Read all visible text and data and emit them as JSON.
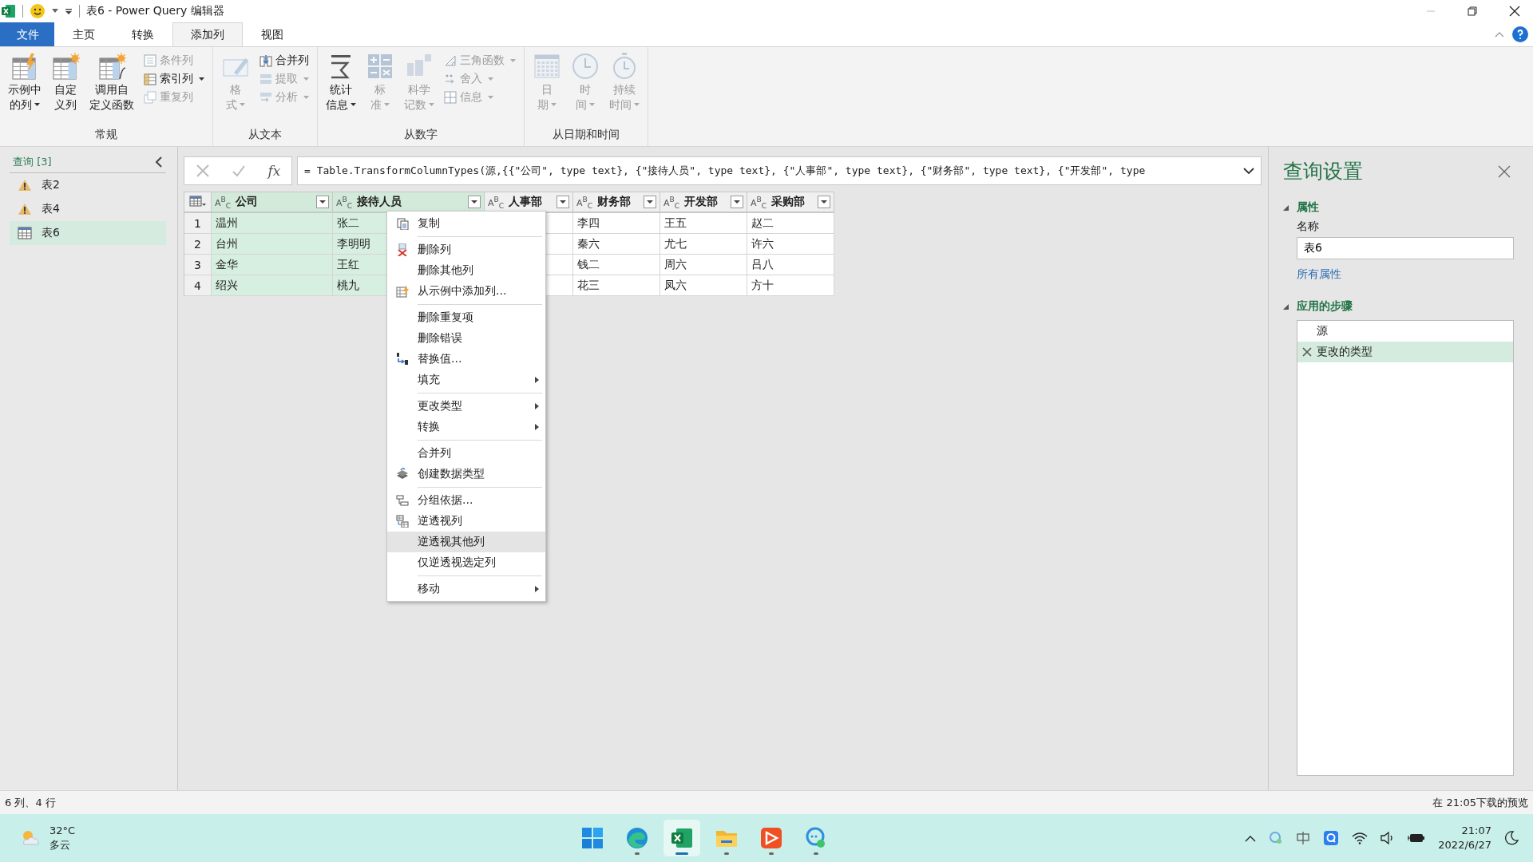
{
  "window": {
    "title": "表6 - Power Query 编辑器"
  },
  "ribbon": {
    "tabs": [
      {
        "label": "文件",
        "kind": "file",
        "selected": false
      },
      {
        "label": "主页",
        "kind": "tab",
        "selected": false
      },
      {
        "label": "转换",
        "kind": "tab",
        "selected": false
      },
      {
        "label": "添加列",
        "kind": "tab",
        "selected": true
      },
      {
        "label": "视图",
        "kind": "tab",
        "selected": false
      }
    ],
    "groups": [
      {
        "label": "常规",
        "large": [
          {
            "lines": [
              "示例中",
              "的列"
            ],
            "dropdown": true,
            "disabled": false
          },
          {
            "lines": [
              "自定",
              "义列"
            ],
            "dropdown": false,
            "disabled": false
          },
          {
            "lines": [
              "调用自",
              "定义函数"
            ],
            "dropdown": false,
            "disabled": false
          }
        ],
        "small": [
          {
            "label": "条件列",
            "dropdown": false,
            "disabled": true
          },
          {
            "label": "索引列",
            "dropdown": true,
            "disabled": false
          },
          {
            "label": "重复列",
            "dropdown": false,
            "disabled": true
          }
        ]
      },
      {
        "label": "从文本",
        "large": [
          {
            "lines": [
              "格",
              "式"
            ],
            "dropdown": true,
            "disabled": true
          }
        ],
        "small": [
          {
            "label": "合并列",
            "dropdown": false,
            "disabled": false
          },
          {
            "label": "提取",
            "dropdown": true,
            "disabled": true
          },
          {
            "label": "分析",
            "dropdown": true,
            "disabled": true
          }
        ]
      },
      {
        "label": "从数字",
        "large": [
          {
            "lines": [
              "统计",
              "信息"
            ],
            "dropdown": true,
            "disabled": false
          },
          {
            "lines": [
              "标",
              "准"
            ],
            "dropdown": true,
            "disabled": true
          },
          {
            "lines": [
              "科学",
              "记数"
            ],
            "dropdown": true,
            "disabled": true
          }
        ],
        "small": [
          {
            "label": "三角函数",
            "dropdown": true,
            "disabled": true
          },
          {
            "label": "舍入",
            "dropdown": true,
            "disabled": true
          },
          {
            "label": "信息",
            "dropdown": true,
            "disabled": true
          }
        ]
      },
      {
        "label": "从日期和时间",
        "large": [
          {
            "lines": [
              "日",
              "期"
            ],
            "dropdown": true,
            "disabled": true
          },
          {
            "lines": [
              "时",
              "间"
            ],
            "dropdown": true,
            "disabled": true
          },
          {
            "lines": [
              "持续",
              "时间"
            ],
            "dropdown": true,
            "disabled": true
          }
        ]
      }
    ]
  },
  "queries": {
    "header": "查询 [3]",
    "items": [
      {
        "name": "表2",
        "kind": "warning",
        "selected": false
      },
      {
        "name": "表4",
        "kind": "warning",
        "selected": false
      },
      {
        "name": "表6",
        "kind": "table",
        "selected": true
      }
    ]
  },
  "formula_bar": {
    "fx_label": "fx",
    "formula": "= Table.TransformColumnTypes(源,{{\"公司\", type text}, {\"接待人员\", type text}, {\"人事部\", type text}, {\"财务部\", type text}, {\"开发部\", type"
  },
  "table": {
    "row_numbers": [
      "1",
      "2",
      "3",
      "4"
    ],
    "columns": [
      {
        "type": "A$^{B}$$_{C}$",
        "header": "公司",
        "selected": true,
        "values": [
          "温州",
          "台州",
          "金华",
          "绍兴"
        ]
      },
      {
        "type": "A$^{B}$$_{C}$",
        "header": "接待人员",
        "selected": true,
        "values": [
          "张二",
          "李明明",
          "王红",
          "桃九"
        ]
      },
      {
        "type": "A$^{B}$$_{C}$",
        "header": "人事部",
        "selected": false
      },
      {
        "type": "A$^{B}$$_{C}$",
        "header": "财务部",
        "selected": false,
        "values": [
          "李四",
          "秦六",
          "钱二",
          "花三"
        ]
      },
      {
        "type": "A$^{B}$$_{C}$",
        "header": "开发部",
        "selected": false,
        "values": [
          "王五",
          "尤七",
          "周六",
          "凤六"
        ]
      },
      {
        "type": "A$^{B}$$_{C}$",
        "header": "采购部",
        "selected": false,
        "values": [
          "赵二",
          "许六",
          "吕八",
          "方十"
        ]
      }
    ]
  },
  "context_menu": {
    "groups": [
      {
        "items": [
          {
            "label": "复制",
            "submenu": false,
            "selected": false
          }
        ]
      },
      {
        "items": [
          {
            "label": "删除列",
            "submenu": false,
            "selected": false
          },
          {
            "label": "删除其他列",
            "submenu": false,
            "selected": false
          },
          {
            "label": "从示例中添加列...",
            "submenu": false,
            "selected": false
          }
        ]
      },
      {
        "items": [
          {
            "label": "删除重复项",
            "submenu": false,
            "selected": false
          },
          {
            "label": "删除错误",
            "submenu": false,
            "selected": false
          },
          {
            "label": "替换值...",
            "submenu": false,
            "selected": false
          },
          {
            "label": "填充",
            "submenu": true,
            "selected": false
          }
        ]
      },
      {
        "items": [
          {
            "label": "更改类型",
            "submenu": true,
            "selected": false
          },
          {
            "label": "转换",
            "submenu": true,
            "selected": false
          }
        ]
      },
      {
        "items": [
          {
            "label": "合并列",
            "submenu": false,
            "selected": false
          },
          {
            "label": "创建数据类型",
            "submenu": false,
            "selected": false
          }
        ]
      },
      {
        "items": [
          {
            "label": "分组依据...",
            "submenu": false,
            "selected": false
          },
          {
            "label": "逆透视列",
            "submenu": false,
            "selected": false
          },
          {
            "label": "逆透视其他列",
            "submenu": false,
            "selected": true
          },
          {
            "label": "仅逆透视选定列",
            "submenu": false,
            "selected": false
          }
        ]
      },
      {
        "items": [
          {
            "label": "移动",
            "submenu": true,
            "selected": false
          }
        ]
      }
    ]
  },
  "query_settings": {
    "title": "查询设置",
    "properties_heading": "属性",
    "name_label": "名称",
    "name_value": "表6",
    "all_properties_link": "所有属性",
    "steps_heading": "应用的步骤",
    "steps": [
      {
        "name": "源",
        "selected": false
      },
      {
        "name": "更改的类型",
        "selected": true
      }
    ]
  },
  "status_bar": {
    "left": "6 列、4 行",
    "right": "在 21:05下载的预览"
  },
  "taskbar": {
    "weather": {
      "temp": "32°C",
      "condition": "多云"
    },
    "apps": [
      {
        "kind": "windows",
        "running": false,
        "selected": false
      },
      {
        "kind": "edge",
        "running": true,
        "selected": false
      },
      {
        "kind": "excel",
        "running": true,
        "selected": true
      },
      {
        "kind": "folder",
        "running": true,
        "selected": false
      },
      {
        "kind": "player",
        "running": true,
        "selected": false
      },
      {
        "kind": "chat",
        "running": true,
        "selected": false
      }
    ],
    "clock": {
      "time": "21:07",
      "date": "2022/6/27"
    }
  }
}
